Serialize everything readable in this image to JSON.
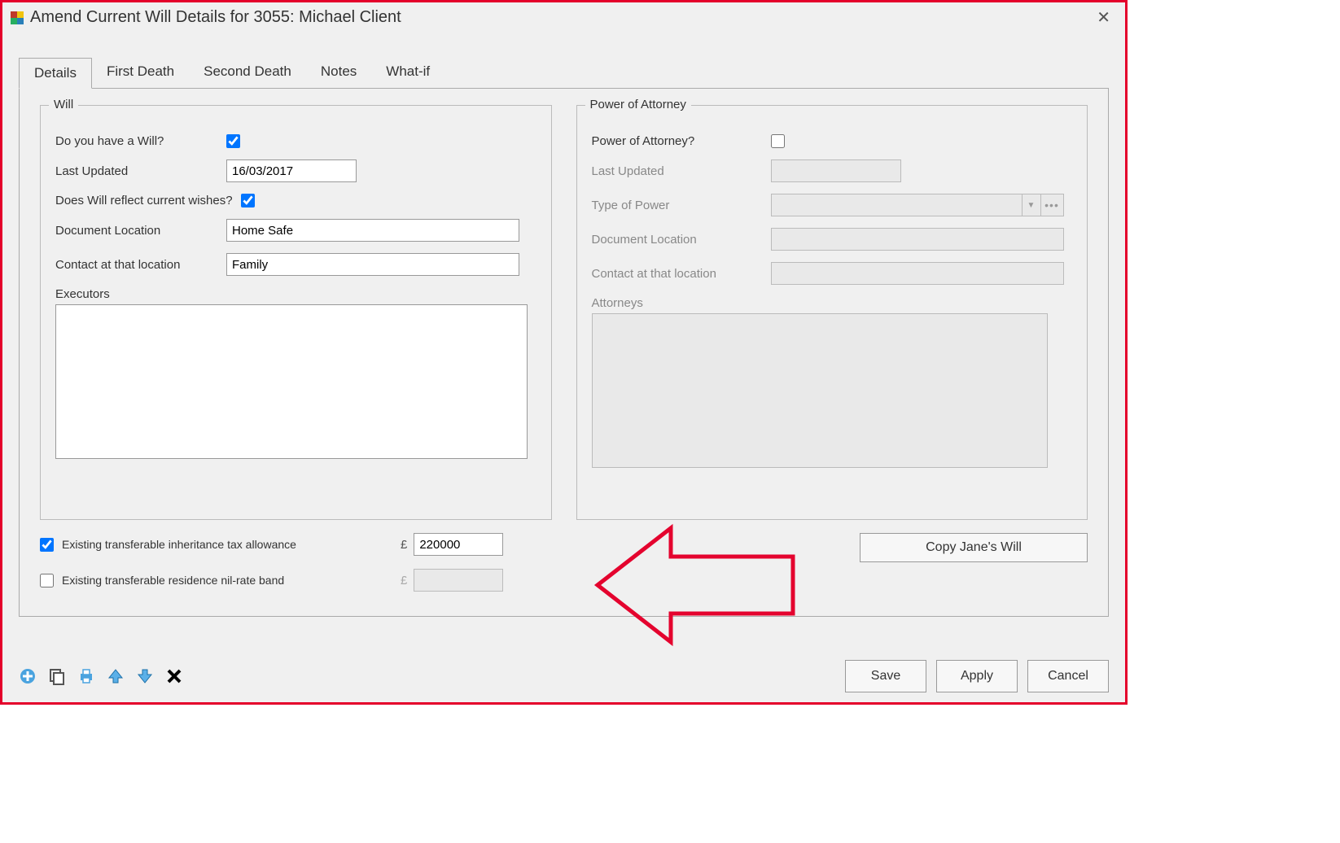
{
  "window": {
    "title": "Amend Current Will Details for 3055: Michael Client"
  },
  "tabs": {
    "details": "Details",
    "first_death": "First Death",
    "second_death": "Second Death",
    "notes": "Notes",
    "what_if": "What-if"
  },
  "will": {
    "legend": "Will",
    "have_will_label": "Do you have a Will?",
    "have_will_checked": true,
    "last_updated_label": "Last Updated",
    "last_updated_value": "16/03/2017",
    "reflect_wishes_label": "Does Will reflect current wishes?",
    "reflect_wishes_checked": true,
    "doc_location_label": "Document Location",
    "doc_location_value": "Home Safe",
    "contact_label": "Contact at that location",
    "contact_value": "Family",
    "executors_label": "Executors",
    "executors_value": ""
  },
  "poa": {
    "legend": "Power of Attorney",
    "has_poa_label": "Power of Attorney?",
    "has_poa_checked": false,
    "last_updated_label": "Last Updated",
    "last_updated_value": "",
    "type_label": "Type of Power",
    "type_value": "",
    "doc_location_label": "Document Location",
    "doc_location_value": "",
    "contact_label": "Contact at that location",
    "contact_value": "",
    "attorneys_label": "Attorneys",
    "attorneys_value": ""
  },
  "allowances": {
    "iht_label": "Existing transferable inheritance tax allowance",
    "iht_checked": true,
    "iht_currency": "£",
    "iht_value": "220000",
    "nrb_label": "Existing transferable residence nil-rate band",
    "nrb_checked": false,
    "nrb_currency": "£",
    "nrb_value": ""
  },
  "buttons": {
    "copy_will": "Copy Jane's Will",
    "save": "Save",
    "apply": "Apply",
    "cancel": "Cancel"
  }
}
